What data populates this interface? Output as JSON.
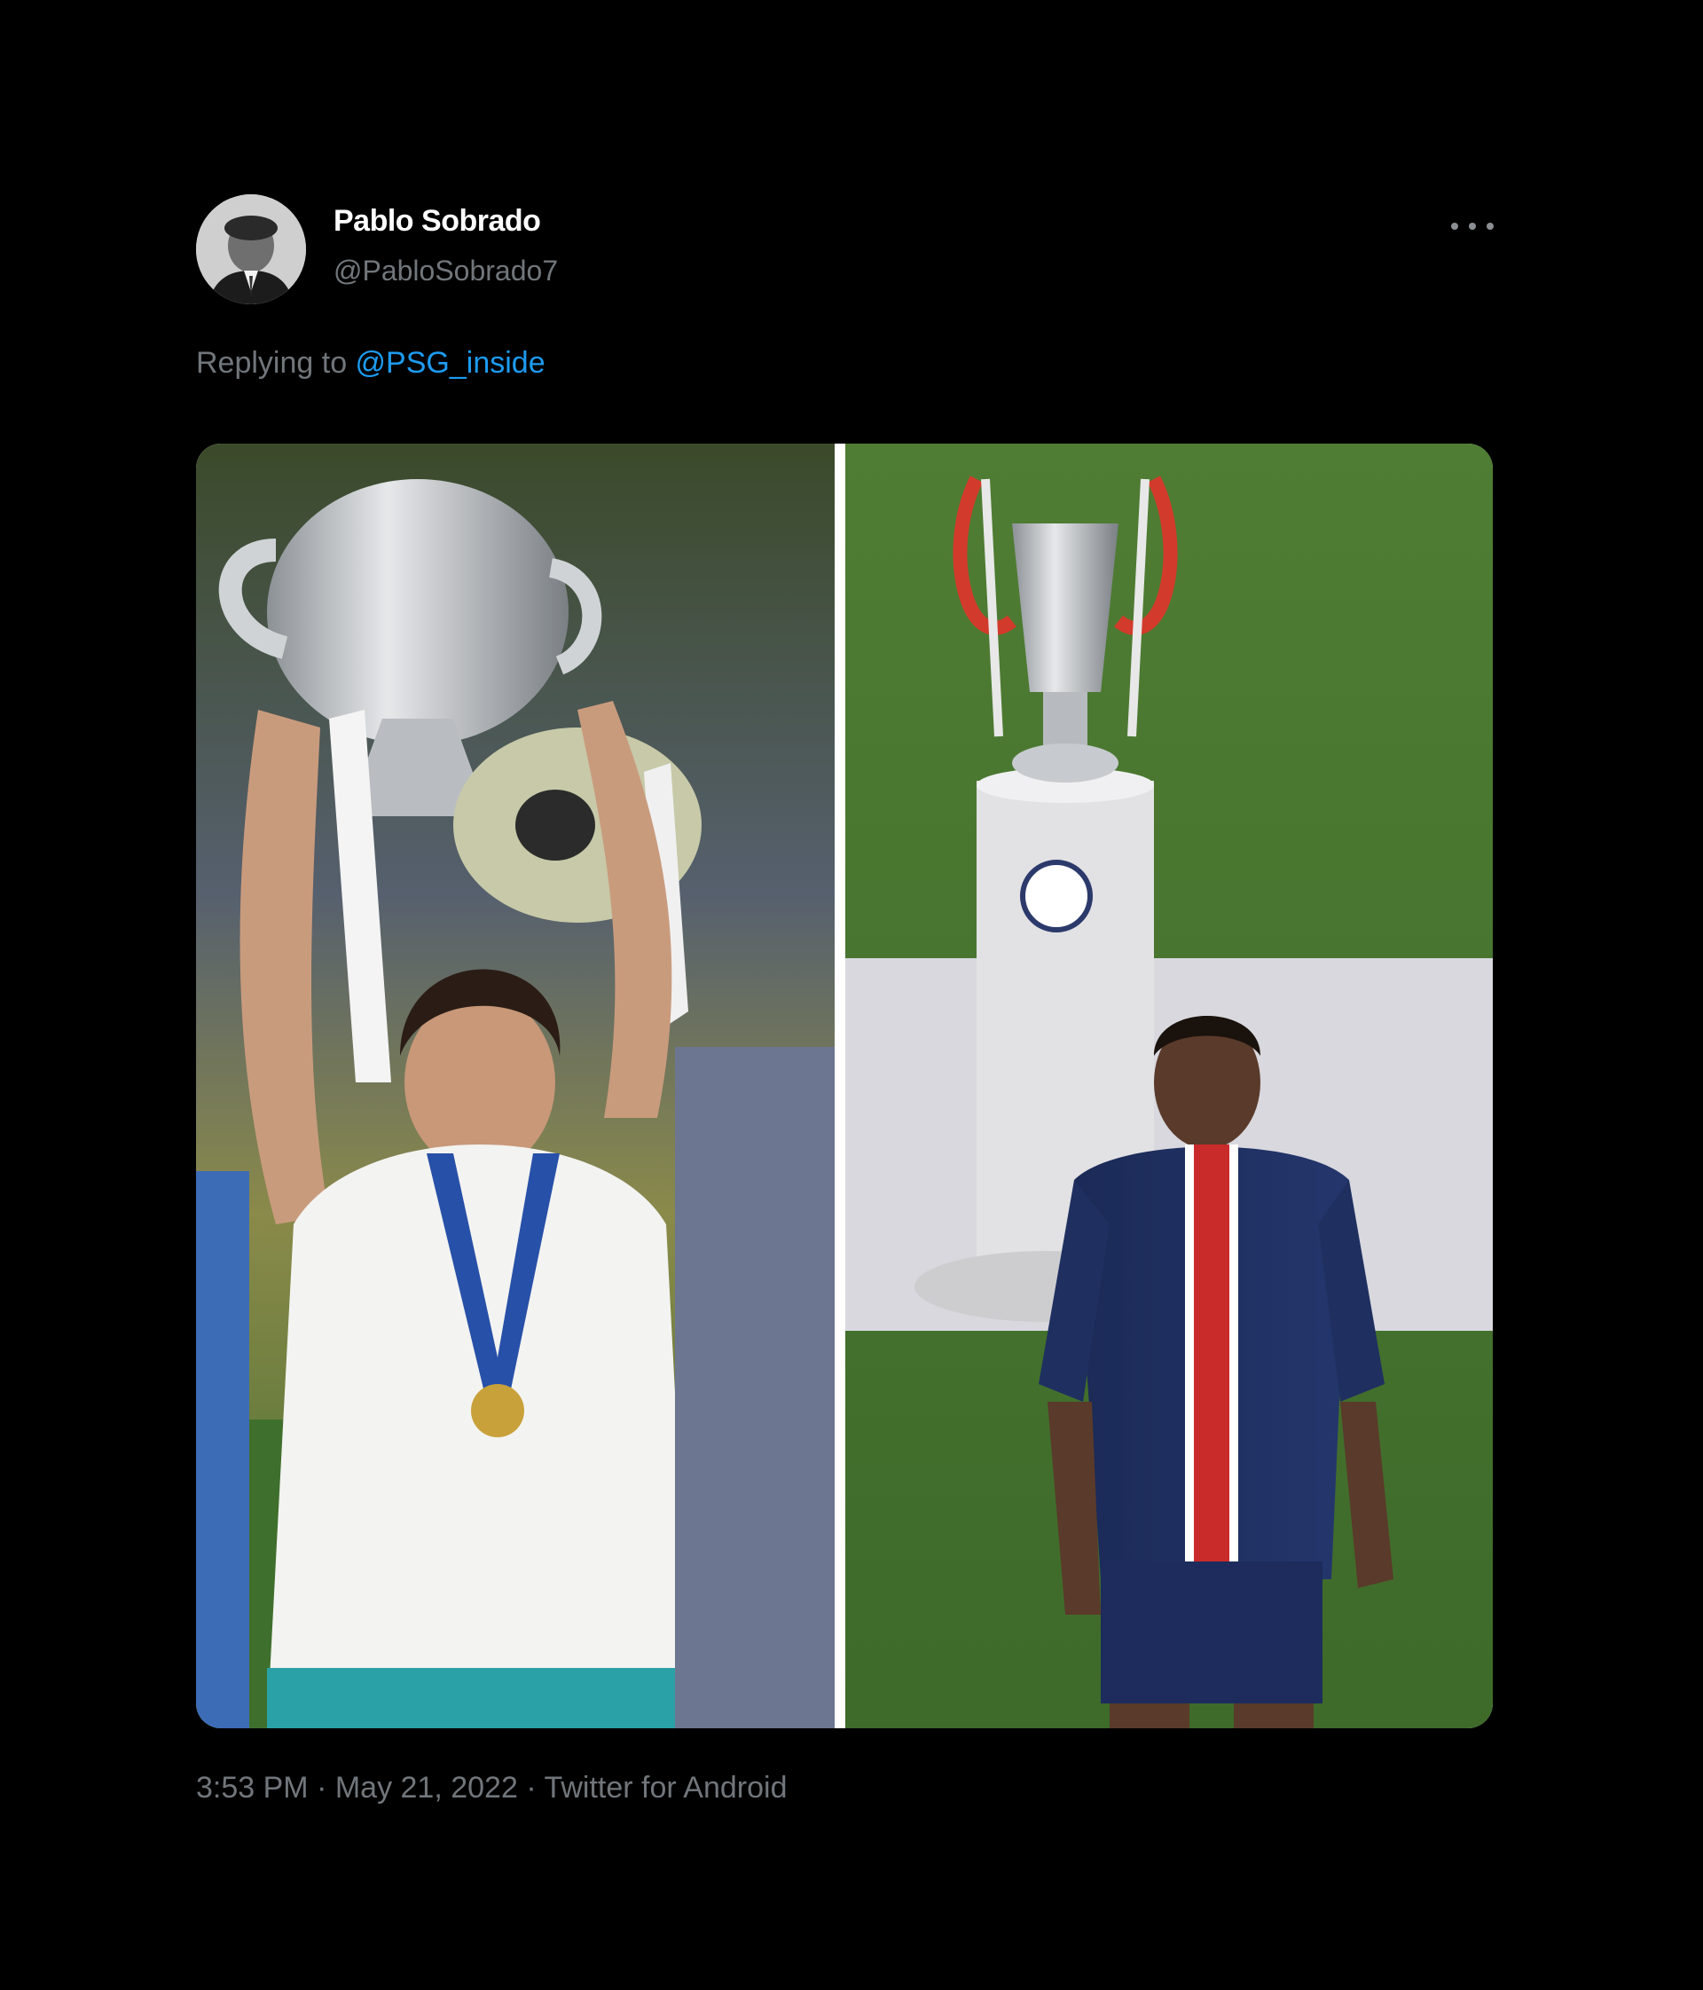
{
  "tweet": {
    "author": {
      "display_name": "Pablo Sobrado",
      "handle": "@PabloSobrado7",
      "avatar_icon": "profile-photo"
    },
    "reply": {
      "prefix": "Replying to ",
      "mention": "@PSG_inside"
    },
    "media": {
      "left_panel": "player-lifting-trophy-photo",
      "right_panel": "player-walking-past-trophy-photo"
    },
    "meta": {
      "time": "3:53 PM",
      "separator": " · ",
      "date": "May 21, 2022",
      "source": "Twitter for Android"
    },
    "colors": {
      "background": "#000000",
      "link": "#1d9bf0",
      "secondary_text": "#71767b"
    }
  }
}
